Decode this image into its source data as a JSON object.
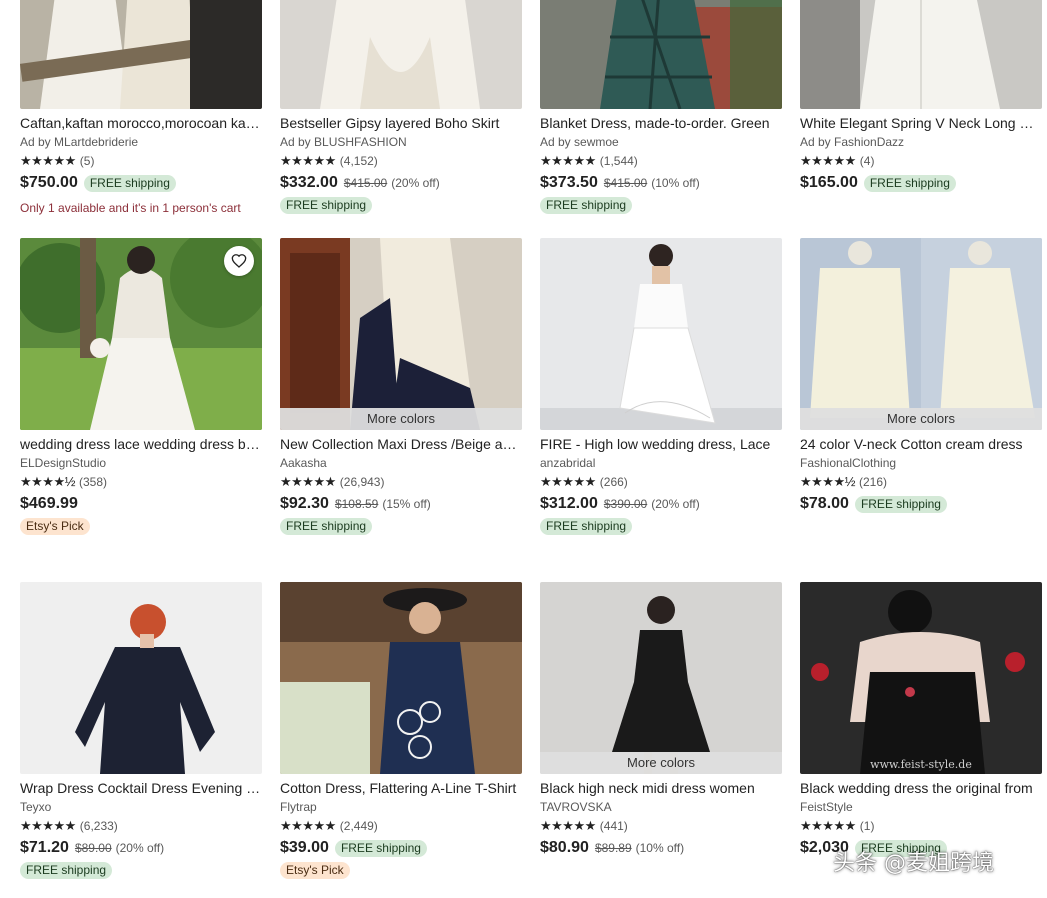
{
  "listings": [
    {
      "title": "Caftan,kaftan morocco,morocoan kaftan dress",
      "seller": "Ad by MLartdebriderie",
      "stars": "★★★★★",
      "reviews": "(5)",
      "price": "$750.00",
      "orig": "",
      "discount": "",
      "inline_badge": "FREE shipping",
      "badge": "",
      "note": "Only 1 available and it's in 1 person's cart",
      "more": ""
    },
    {
      "title": "Bestseller Gipsy layered Boho Skirt",
      "seller": "Ad by BLUSHFASHION",
      "stars": "★★★★★",
      "reviews": "(4,152)",
      "price": "$332.00",
      "orig": "$415.00",
      "discount": "(20% off)",
      "inline_badge": "",
      "badge": "FREE shipping",
      "note": "",
      "more": ""
    },
    {
      "title": "Blanket Dress, made-to-order. Green",
      "seller": "Ad by sewmoe",
      "stars": "★★★★★",
      "reviews": "(1,544)",
      "price": "$373.50",
      "orig": "$415.00",
      "discount": "(10% off)",
      "inline_badge": "",
      "badge": "FREE shipping",
      "note": "",
      "more": ""
    },
    {
      "title": "White Elegant Spring V Neck Long Coat",
      "seller": "Ad by FashionDazz",
      "stars": "★★★★★",
      "reviews": "(4)",
      "price": "$165.00",
      "orig": "",
      "discount": "",
      "inline_badge": "FREE shipping",
      "badge": "",
      "note": "",
      "more": ""
    },
    {
      "title": "wedding dress lace wedding dress boho",
      "seller": "ELDesignStudio",
      "stars": "★★★★½",
      "reviews": "(358)",
      "price": "$469.99",
      "orig": "",
      "discount": "",
      "inline_badge": "",
      "badge": "Etsy's Pick",
      "note": "",
      "more": ""
    },
    {
      "title": "New Collection Maxi Dress /Beige and Navy",
      "seller": "Aakasha",
      "stars": "★★★★★",
      "reviews": "(26,943)",
      "price": "$92.30",
      "orig": "$108.59",
      "discount": "(15% off)",
      "inline_badge": "",
      "badge": "FREE shipping",
      "note": "",
      "more": "More colors"
    },
    {
      "title": "FIRE - High low wedding dress, Lace",
      "seller": "anzabridal",
      "stars": "★★★★★",
      "reviews": "(266)",
      "price": "$312.00",
      "orig": "$390.00",
      "discount": "(20% off)",
      "inline_badge": "",
      "badge": "FREE shipping",
      "note": "",
      "more": ""
    },
    {
      "title": "24 color V-neck Cotton cream dress",
      "seller": "FashionalClothing",
      "stars": "★★★★½",
      "reviews": "(216)",
      "price": "$78.00",
      "orig": "",
      "discount": "",
      "inline_badge": "FREE shipping",
      "badge": "",
      "note": "",
      "more": "More colors"
    },
    {
      "title": "Wrap Dress Cocktail Dress Evening Dress",
      "seller": "Teyxo",
      "stars": "★★★★★",
      "reviews": "(6,233)",
      "price": "$71.20",
      "orig": "$89.00",
      "discount": "(20% off)",
      "inline_badge": "",
      "badge": "FREE shipping",
      "note": "",
      "more": ""
    },
    {
      "title": "Cotton Dress, Flattering A-Line T-Shirt",
      "seller": "Flytrap",
      "stars": "★★★★★",
      "reviews": "(2,449)",
      "price": "$39.00",
      "orig": "",
      "discount": "",
      "inline_badge": "FREE shipping",
      "badge": "Etsy's Pick",
      "note": "",
      "more": ""
    },
    {
      "title": "Black high neck midi dress women",
      "seller": "TAVROVSKA",
      "stars": "★★★★★",
      "reviews": "(441)",
      "price": "$80.90",
      "orig": "$89.89",
      "discount": "(10% off)",
      "inline_badge": "",
      "badge": "",
      "note": "",
      "more": "More colors"
    },
    {
      "title": "Black wedding dress the original from",
      "seller": "FeistStyle",
      "stars": "★★★★★",
      "reviews": "(1)",
      "price": "$2,030",
      "orig": "",
      "discount": "",
      "inline_badge": "FREE shipping",
      "badge": "",
      "note": "",
      "more": ""
    }
  ],
  "watermark": "头条 @麦姐跨境",
  "image_caption_12": "www.feist-style.de",
  "colors": {
    "badge_ship": "#d4e9d7",
    "badge_pick": "#fde4cf",
    "accent": "#222222"
  }
}
